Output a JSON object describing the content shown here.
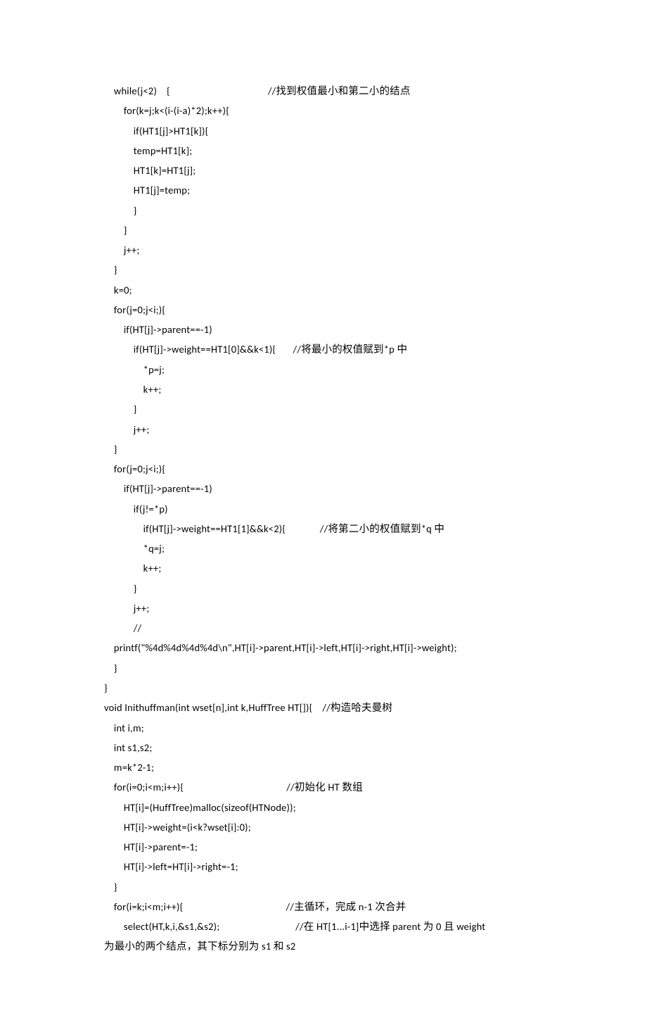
{
  "code_lines": [
    "    while(j<2)    {                                        //找到权值最小和第二小的结点",
    "        for(k=j;k<(i-(i-a)*2);k++){",
    "            if(HT1[j]>HT1[k]){",
    "            temp=HT1[k];",
    "            HT1[k]=HT1[j];",
    "            HT1[j]=temp;",
    "            }",
    "        }",
    "        j++;",
    "    }",
    "    k=0;",
    "    for(j=0;j<i;){",
    "        if(HT[j]->parent==-1)",
    "            if(HT[j]->weight==HT1[0]&&k<1){       //将最小的权值赋到*p 中",
    "                *p=j;",
    "                k++;",
    "            }",
    "            j++;",
    "    }",
    "    for(j=0;j<i;){",
    "        if(HT[j]->parent==-1)",
    "            if(j!=*p)",
    "                if(HT[j]->weight==HT1[1]&&k<2){              //将第二小的权值赋到*q 中",
    "                *q=j;",
    "                k++;",
    "            }",
    "            j++;",
    "            //",
    "    printf(\"%4d%4d%4d%4d\\n\",HT[i]->parent,HT[i]->left,HT[i]->right,HT[i]->weight);",
    "    }",
    "}",
    "void Inithuffman(int wset[n],int k,HuffTree HT[]){    //构造哈夫曼树",
    "    int i,m;",
    "    int s1,s2;",
    "    m=k*2-1;",
    "    for(i=0;i<m;i++){                                          //初始化 HT 数组",
    "        HT[i]=(HuffTree)malloc(sizeof(HTNode));",
    "        HT[i]->weight=(i<k?wset[i]:0);",
    "        HT[i]->parent=-1;",
    "        HT[i]->left=HT[i]->right=-1;",
    "    }",
    "    for(i=k;i<m;i++){                                          //主循环，完成 n-1 次合并",
    "        select(HT,k,i,&s1,&s2);                               //在 HT[1...i-1]中选择 parent 为 0 且 weight",
    "为最小的两个结点，其下标分别为 s1 和 s2"
  ]
}
